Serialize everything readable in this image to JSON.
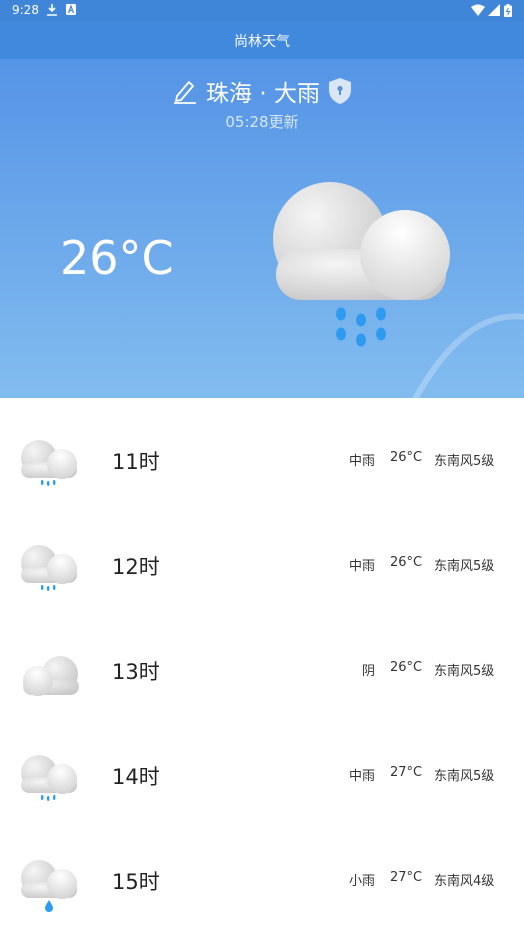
{
  "status_bar": {
    "time": "9:28"
  },
  "app": {
    "title": "尚林天气"
  },
  "current": {
    "location": "珠海 · 大雨",
    "updated": "05:28更新",
    "temperature": "26°C"
  },
  "hourly": [
    {
      "hour": "11时",
      "condition": "中雨",
      "temp": "26°C",
      "wind": "东南风5级",
      "icon": "moderate-rain-icon"
    },
    {
      "hour": "12时",
      "condition": "中雨",
      "temp": "26°C",
      "wind": "东南风5级",
      "icon": "moderate-rain-icon"
    },
    {
      "hour": "13时",
      "condition": "阴",
      "temp": "26°C",
      "wind": "东南风5级",
      "icon": "overcast-icon"
    },
    {
      "hour": "14时",
      "condition": "中雨",
      "temp": "27°C",
      "wind": "东南风5级",
      "icon": "moderate-rain-icon"
    },
    {
      "hour": "15时",
      "condition": "小雨",
      "temp": "27°C",
      "wind": "东南风4级",
      "icon": "light-rain-icon"
    }
  ],
  "colors": {
    "header": "#4189dd",
    "hero_top": "#5594e6",
    "hero_bottom": "#82bcef",
    "rain": "#2f9bf0"
  }
}
